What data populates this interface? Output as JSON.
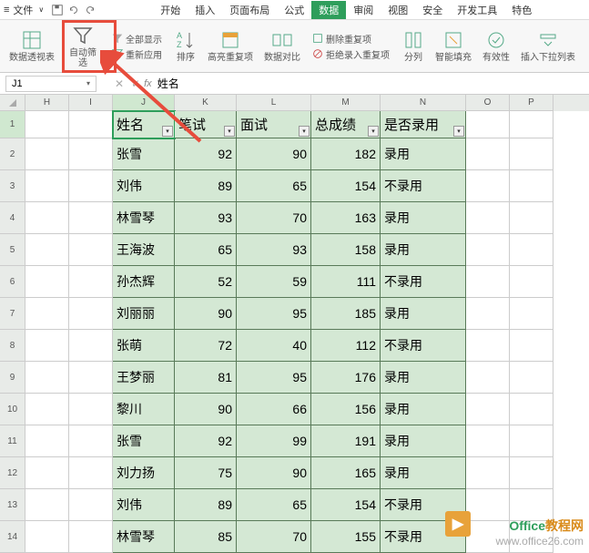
{
  "topbar": {
    "file": "文件"
  },
  "tabs": {
    "items": [
      "开始",
      "插入",
      "页面布局",
      "公式",
      "数据",
      "审阅",
      "视图",
      "安全",
      "开发工具",
      "特色"
    ],
    "active_index": 4
  },
  "ribbon": {
    "pivot": "数据透视表",
    "autofilter": "自动筛选",
    "showall": "全部显示",
    "reapply": "重新应用",
    "sort": "排序",
    "highlight": "高亮重复项",
    "compare": "数据对比",
    "remove_dup_top": "删除重复项",
    "reject_dup": "拒绝录入重复项",
    "split": "分列",
    "smart_fill": "智能填充",
    "validation": "有效性",
    "insert_dropdown": "插入下拉列表"
  },
  "namebox": {
    "ref": "J1",
    "value": "姓名"
  },
  "columns": [
    "H",
    "I",
    "J",
    "K",
    "L",
    "M",
    "N",
    "O",
    "P"
  ],
  "headers": {
    "J": "姓名",
    "K": "笔试",
    "L": "面试",
    "M": "总成绩",
    "N": "是否录用"
  },
  "rows": [
    {
      "n": 2,
      "J": "张雪",
      "K": 92,
      "L": 90,
      "M": 182,
      "N": "录用"
    },
    {
      "n": 3,
      "J": "刘伟",
      "K": 89,
      "L": 65,
      "M": 154,
      "N": "不录用"
    },
    {
      "n": 4,
      "J": "林雪琴",
      "K": 93,
      "L": 70,
      "M": 163,
      "N": "录用"
    },
    {
      "n": 5,
      "J": "王海波",
      "K": 65,
      "L": 93,
      "M": 158,
      "N": "录用"
    },
    {
      "n": 6,
      "J": "孙杰辉",
      "K": 52,
      "L": 59,
      "M": 111,
      "N": "不录用"
    },
    {
      "n": 7,
      "J": "刘丽丽",
      "K": 90,
      "L": 95,
      "M": 185,
      "N": "录用"
    },
    {
      "n": 8,
      "J": "张萌",
      "K": 72,
      "L": 40,
      "M": 112,
      "N": "不录用"
    },
    {
      "n": 9,
      "J": "王梦丽",
      "K": 81,
      "L": 95,
      "M": 176,
      "N": "录用"
    },
    {
      "n": 10,
      "J": "黎川",
      "K": 90,
      "L": 66,
      "M": 156,
      "N": "录用"
    },
    {
      "n": 11,
      "J": "张雪",
      "K": 92,
      "L": 99,
      "M": 191,
      "N": "录用"
    },
    {
      "n": 12,
      "J": "刘力扬",
      "K": 75,
      "L": 90,
      "M": 165,
      "N": "录用"
    },
    {
      "n": 13,
      "J": "刘伟",
      "K": 89,
      "L": 65,
      "M": 154,
      "N": "不录用"
    },
    {
      "n": 14,
      "J": "林雪琴",
      "K": 85,
      "L": 70,
      "M": 155,
      "N": "不录用"
    }
  ],
  "watermark": {
    "line1_a": "Office",
    "line1_b": "教程网",
    "line2": "www.office26.com"
  }
}
